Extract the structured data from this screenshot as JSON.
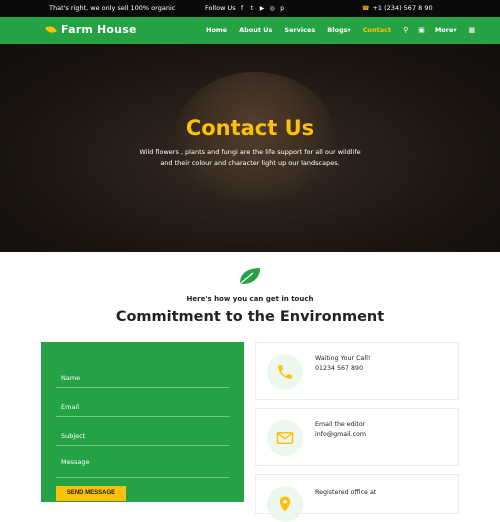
{
  "topbar": {
    "tagline": "That's right, we only sell 100% organic",
    "follow_label": "Follow Us",
    "social_icons": [
      "facebook-icon",
      "twitter-icon",
      "youtube-icon",
      "instagram-icon",
      "pinterest-icon"
    ],
    "social_glyphs": [
      "f",
      "t",
      "▶",
      "◎",
      "p"
    ],
    "phone": "+1 (234) 567 8 90"
  },
  "nav": {
    "logo_text": "Farm House",
    "items": [
      "Home",
      "About Us",
      "Services",
      "Blogs",
      "Contact",
      "More"
    ],
    "active": "Contact",
    "dropdown_items": [
      "Blogs",
      "More"
    ]
  },
  "hero": {
    "title": "Contact Us",
    "line1": "Wild flowers , plants and fungi are the life support for all our wildlife",
    "line2": "and their colour and character light up our landscapes."
  },
  "section": {
    "subtitle": "Here's how you can get in touch",
    "title": "Commitment to the Environment"
  },
  "form": {
    "name_placeholder": "Name",
    "email_placeholder": "Email",
    "subject_placeholder": "Subject",
    "message_placeholder": "Message",
    "send_label": "SEND MESSAGE"
  },
  "contacts": [
    {
      "icon": "phone-icon",
      "label": "Waiting Your Call!",
      "value": "01234 567 890"
    },
    {
      "icon": "envelope-icon",
      "label": "Email the editor",
      "value": "info@gmail.com"
    },
    {
      "icon": "location-icon",
      "label": "Registered office at",
      "value": ""
    }
  ],
  "colors": {
    "brand_green": "#25a244",
    "accent_yellow": "#ffc107",
    "topbar_black": "#0b0b0b"
  }
}
